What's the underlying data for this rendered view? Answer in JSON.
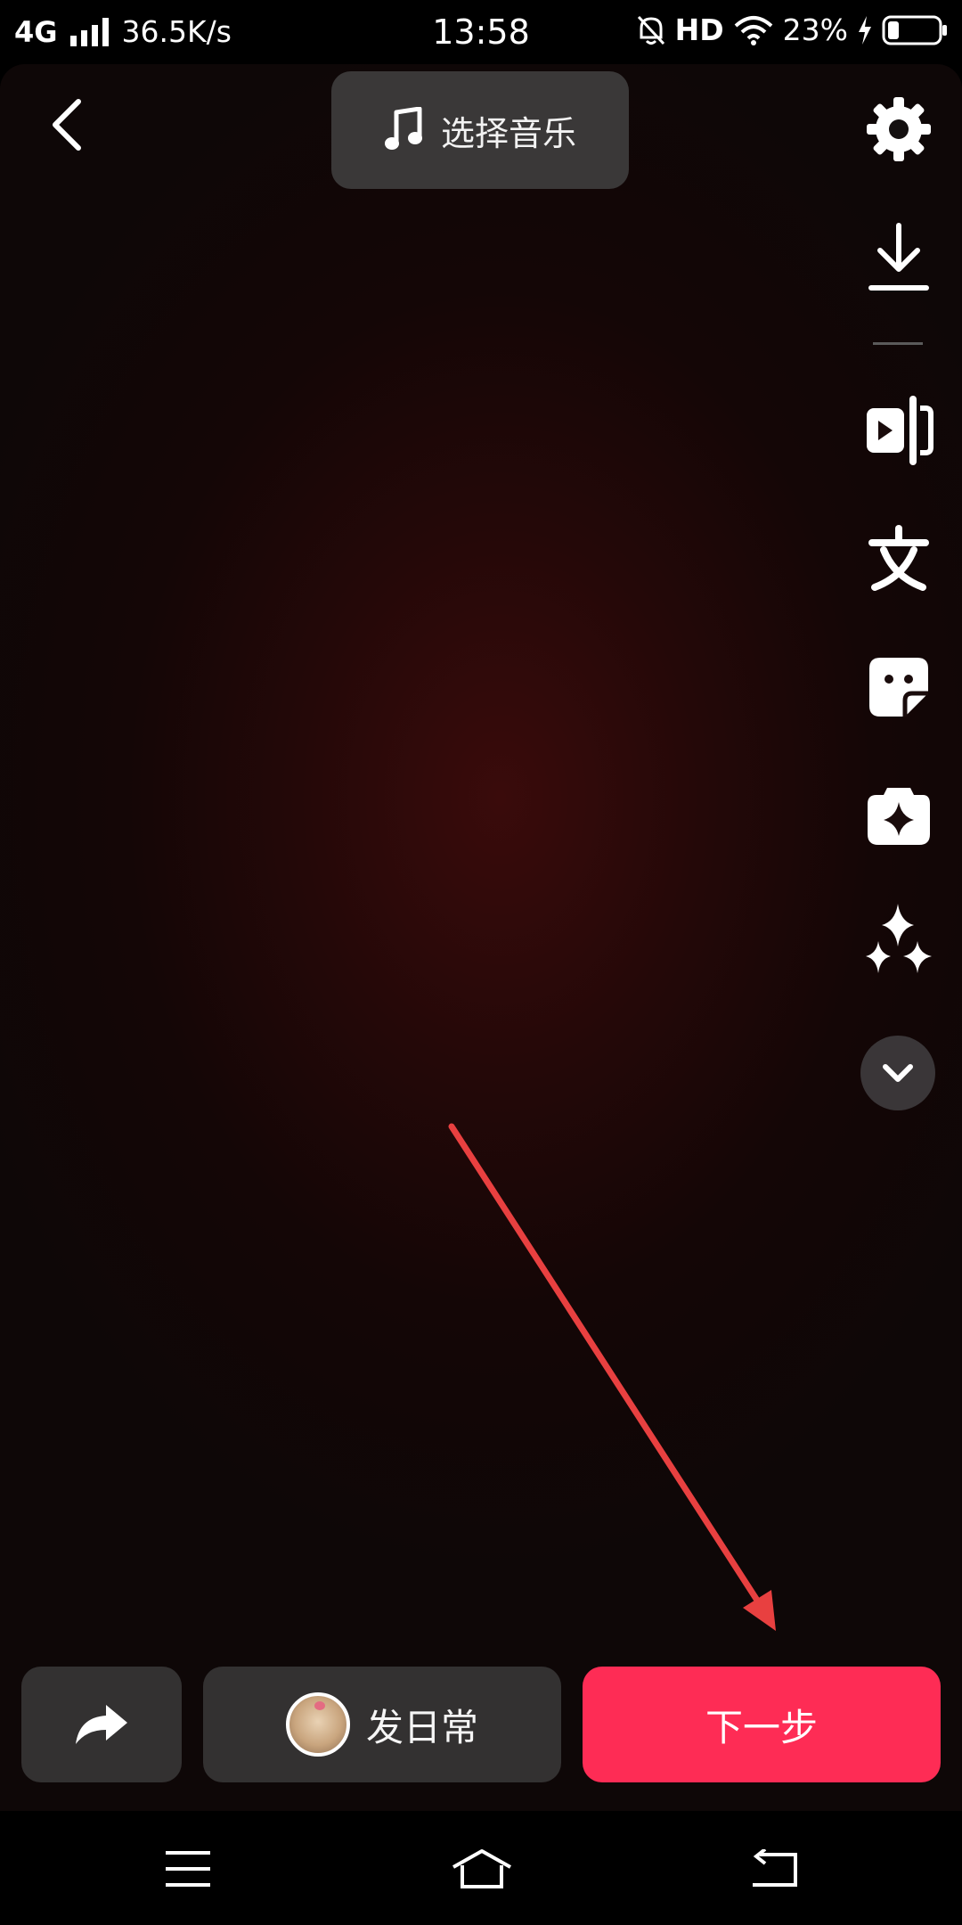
{
  "status_bar": {
    "network": "4G",
    "speed": "36.5K/s",
    "time": "13:58",
    "hd": "HD",
    "battery_pct": "23%",
    "battery_level": 0.23
  },
  "header": {
    "music_label": "选择音乐"
  },
  "toolbar": {
    "icons": [
      "settings-icon",
      "download-icon",
      "video-clip-icon",
      "text-icon",
      "sticker-icon",
      "effects-icon",
      "sparkle-icon",
      "chevron-down-icon"
    ]
  },
  "bottom": {
    "daily_label": "发日常",
    "next_label": "下一步"
  },
  "colors": {
    "accent": "#fe2c55",
    "annotation_arrow": "#e84040"
  }
}
